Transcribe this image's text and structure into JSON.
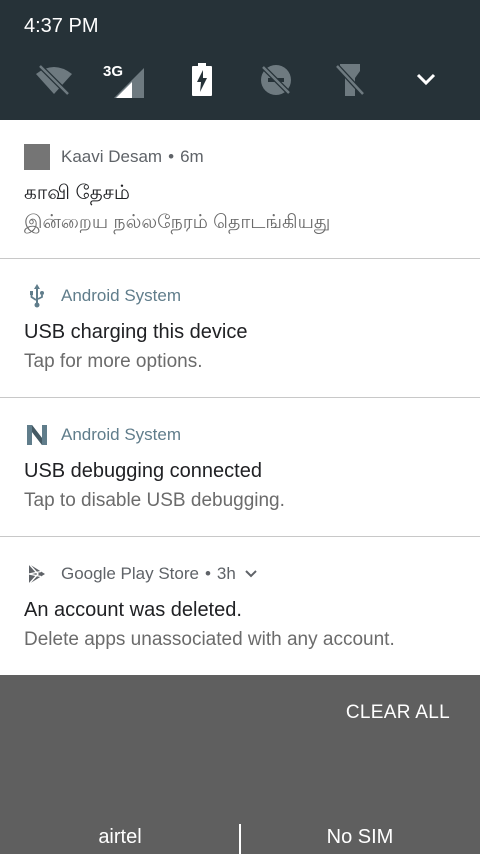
{
  "status": {
    "time": "4:37 PM"
  },
  "quick_settings": {
    "tiles": [
      {
        "icon": "wifi-off-icon"
      },
      {
        "icon": "cellular-3g-icon",
        "label": "3G"
      },
      {
        "icon": "battery-charging-icon"
      },
      {
        "icon": "do-not-disturb-off-icon"
      },
      {
        "icon": "flashlight-off-icon"
      },
      {
        "icon": "expand-chevron-icon"
      }
    ]
  },
  "notifications": [
    {
      "app": "Kaavi Desam",
      "time": "6m",
      "title": "காவி தேசம்",
      "text": "இன்றைய நல்லநேரம் தொடங்கியது",
      "app_color": "#5f6368"
    },
    {
      "app": "Android System",
      "title": "USB charging this device",
      "text": "Tap for more options.",
      "app_color": "#607d8b"
    },
    {
      "app": "Android System",
      "title": "USB debugging connected",
      "text": "Tap to disable USB debugging.",
      "app_color": "#607d8b"
    },
    {
      "app": "Google Play Store",
      "time": "3h",
      "title": "An account was deleted.",
      "text": "Delete apps unassociated with any account.",
      "app_color": "#5f6368"
    }
  ],
  "actions": {
    "clear_all": "CLEAR ALL"
  },
  "carriers": {
    "sim1": "airtel",
    "sim2": "No SIM"
  }
}
